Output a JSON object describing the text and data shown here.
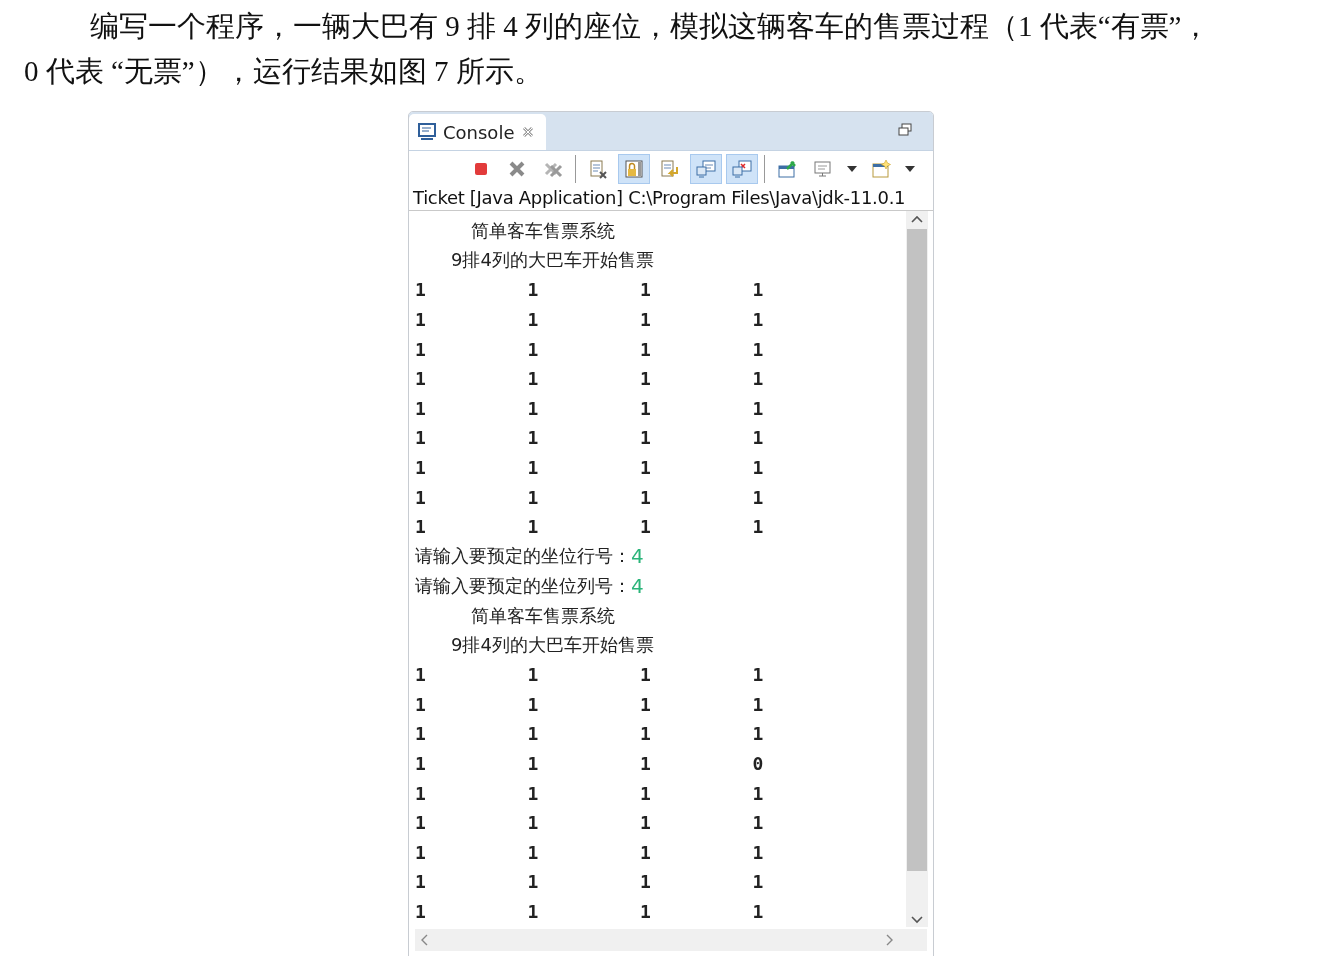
{
  "paragraph": {
    "lines": [
      "编写一个程序，一辆大巴有 9 排 4 列的座位，模拟这辆客车的售票过程（1 代表“有票”，",
      "0 代表 “无票”），运行结果如图 7 所示。"
    ]
  },
  "console": {
    "tab": {
      "label": "Console",
      "selected": true
    },
    "toolbar": [
      {
        "kind": "terminate",
        "pressed": false
      },
      {
        "kind": "remove",
        "pressed": false
      },
      {
        "kind": "remove-all",
        "pressed": false
      },
      {
        "kind": "separator"
      },
      {
        "kind": "clear",
        "pressed": false
      },
      {
        "kind": "scroll-lock",
        "pressed": true
      },
      {
        "kind": "word-wrap",
        "pressed": false
      },
      {
        "kind": "stdout",
        "pressed": true
      },
      {
        "kind": "stderr",
        "pressed": true
      },
      {
        "kind": "separator"
      },
      {
        "kind": "pin",
        "pressed": false
      },
      {
        "kind": "display",
        "pressed": false
      },
      {
        "kind": "dropdown"
      },
      {
        "kind": "new-console",
        "pressed": false
      },
      {
        "kind": "dropdown"
      }
    ],
    "launch_label": "Ticket [Java Application] C:\\Program Files\\Java\\jdk-11.0.1",
    "output": [
      {
        "kind": "title",
        "text": "简单客车售票系统"
      },
      {
        "kind": "subtitle",
        "text": "9排4列的大巴车开始售票"
      },
      {
        "kind": "row",
        "cells": [
          "1",
          "1",
          "1",
          "1"
        ]
      },
      {
        "kind": "row",
        "cells": [
          "1",
          "1",
          "1",
          "1"
        ]
      },
      {
        "kind": "row",
        "cells": [
          "1",
          "1",
          "1",
          "1"
        ]
      },
      {
        "kind": "row",
        "cells": [
          "1",
          "1",
          "1",
          "1"
        ]
      },
      {
        "kind": "row",
        "cells": [
          "1",
          "1",
          "1",
          "1"
        ]
      },
      {
        "kind": "row",
        "cells": [
          "1",
          "1",
          "1",
          "1"
        ]
      },
      {
        "kind": "row",
        "cells": [
          "1",
          "1",
          "1",
          "1"
        ]
      },
      {
        "kind": "row",
        "cells": [
          "1",
          "1",
          "1",
          "1"
        ]
      },
      {
        "kind": "row",
        "cells": [
          "1",
          "1",
          "1",
          "1"
        ]
      },
      {
        "kind": "prompt",
        "text": "请输入要预定的坐位行号：",
        "input": "4"
      },
      {
        "kind": "prompt",
        "text": "请输入要预定的坐位列号：",
        "input": "4"
      },
      {
        "kind": "title",
        "text": "简单客车售票系统"
      },
      {
        "kind": "subtitle",
        "text": "9排4列的大巴车开始售票"
      },
      {
        "kind": "row",
        "cells": [
          "1",
          "1",
          "1",
          "1"
        ]
      },
      {
        "kind": "row",
        "cells": [
          "1",
          "1",
          "1",
          "1"
        ]
      },
      {
        "kind": "row",
        "cells": [
          "1",
          "1",
          "1",
          "1"
        ]
      },
      {
        "kind": "row",
        "cells": [
          "1",
          "1",
          "1",
          "0"
        ]
      },
      {
        "kind": "row",
        "cells": [
          "1",
          "1",
          "1",
          "1"
        ]
      },
      {
        "kind": "row",
        "cells": [
          "1",
          "1",
          "1",
          "1"
        ]
      },
      {
        "kind": "row",
        "cells": [
          "1",
          "1",
          "1",
          "1"
        ]
      },
      {
        "kind": "row",
        "cells": [
          "1",
          "1",
          "1",
          "1"
        ]
      },
      {
        "kind": "row",
        "cells": [
          "1",
          "1",
          "1",
          "1"
        ]
      }
    ]
  }
}
